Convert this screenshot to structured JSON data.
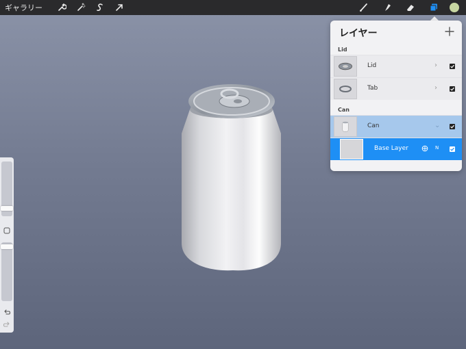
{
  "topbar": {
    "gallery_label": "ギャラリー",
    "left_tools": [
      {
        "name": "wrench-icon"
      },
      {
        "name": "magic-wand-icon"
      },
      {
        "name": "selection-s-icon"
      },
      {
        "name": "transform-arrow-icon"
      }
    ],
    "right_tools": [
      {
        "name": "brush-icon"
      },
      {
        "name": "smudge-icon"
      },
      {
        "name": "eraser-icon"
      },
      {
        "name": "layers-icon"
      }
    ],
    "color_swatch": "#c8d7a2"
  },
  "layers_panel": {
    "title": "レイヤー",
    "groups": [
      {
        "label": "Lid",
        "layers": [
          {
            "name": "Lid",
            "state": "normal"
          },
          {
            "name": "Tab",
            "state": "normal"
          }
        ]
      },
      {
        "label": "Can",
        "layers": [
          {
            "name": "Can",
            "state": "selected"
          },
          {
            "name": "Base Layer",
            "state": "active",
            "blend_mode": "N"
          }
        ]
      }
    ]
  },
  "colors": {
    "accent": "#1e8ff5",
    "selected": "#a6c8ec",
    "topbar": "#2a2a2c"
  }
}
